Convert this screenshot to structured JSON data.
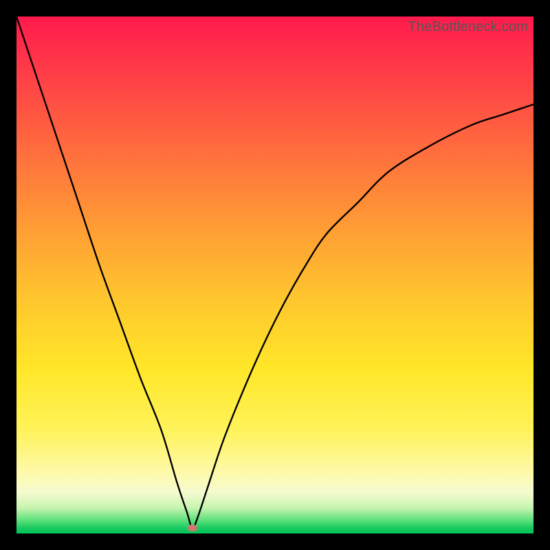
{
  "watermark": "TheBottleneck.com",
  "colors": {
    "frame": "#000000",
    "curve": "#000000",
    "marker": "#c97b70",
    "gradient_top": "#ff1a4d",
    "gradient_bottom": "#00c558"
  },
  "chart_data": {
    "type": "line",
    "title": "",
    "xlabel": "",
    "ylabel": "",
    "xlim": [
      0,
      100
    ],
    "ylim": [
      0,
      100
    ],
    "grid": false,
    "legend": false,
    "annotations": [
      {
        "text": "TheBottleneck.com",
        "position": "top-right"
      }
    ],
    "marker": {
      "x": 34,
      "y": 1
    },
    "series": [
      {
        "name": "bottleneck-curve",
        "x": [
          0,
          4,
          8,
          12,
          16,
          20,
          24,
          28,
          31,
          33,
          34,
          35,
          37,
          40,
          44,
          48,
          52,
          56,
          60,
          66,
          72,
          80,
          88,
          94,
          100
        ],
        "y": [
          100,
          88,
          76,
          64,
          52,
          41,
          30,
          20,
          10,
          4,
          1,
          3,
          9,
          18,
          28,
          37,
          45,
          52,
          58,
          64,
          70,
          75,
          79,
          81,
          83
        ]
      }
    ]
  }
}
